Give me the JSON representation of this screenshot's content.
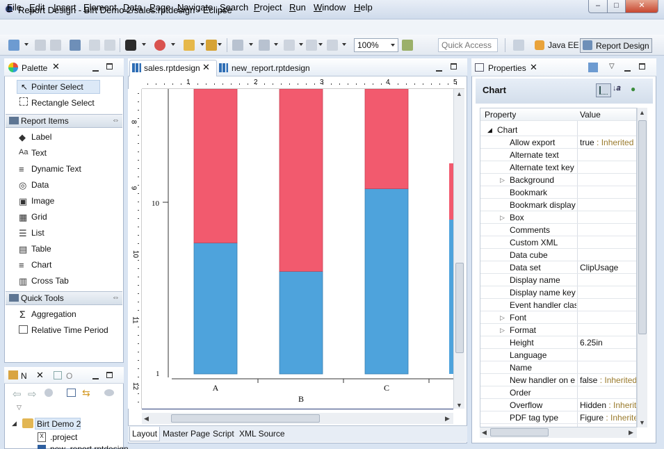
{
  "window": {
    "title": "Report Design - Birt Demo 2/sales.rptdesign - Eclipse"
  },
  "menu": [
    "File",
    "Edit",
    "Insert",
    "Element",
    "Data",
    "Page",
    "Navigate",
    "Search",
    "Project",
    "Run",
    "Window",
    "Help"
  ],
  "toolbar": {
    "zoom": "100%",
    "quick_access": "Quick Access",
    "perspectives": [
      "Java EE",
      "Report Design"
    ]
  },
  "palette": {
    "title": "Palette",
    "tools": [
      "Pointer Select",
      "Rectangle Select"
    ],
    "report_items_label": "Report Items",
    "report_items": [
      "Label",
      "Text",
      "Dynamic Text",
      "Data",
      "Image",
      "Grid",
      "List",
      "Table",
      "Chart",
      "Cross Tab"
    ],
    "quick_tools_label": "Quick Tools",
    "quick_tools": [
      "Aggregation",
      "Relative Time Period"
    ]
  },
  "navigator": {
    "tab_n": "N",
    "tab_o": "O",
    "project": "Birt Demo 2",
    "files": [
      ".project",
      "new_report.rptdesign"
    ]
  },
  "editor": {
    "tabs": [
      "sales.rptdesign",
      "new_report.rptdesign"
    ],
    "ruler_top": [
      "1",
      "2",
      "3",
      "4",
      "5"
    ],
    "ruler_left": [
      "8",
      "9",
      "10",
      "11",
      "12"
    ],
    "bottom_tabs": [
      "Layout",
      "Master Page",
      "Script",
      "XML Source"
    ]
  },
  "chart_data": {
    "type": "bar",
    "stacked": true,
    "categories": [
      "A",
      "B",
      "C"
    ],
    "axis_labels": {
      "ymid": "10",
      "ybottom": "1"
    },
    "colors": {
      "bottom": "#4ea3dc",
      "top": "#f25a6e"
    },
    "series": [
      {
        "values": [
          0.46,
          0.36,
          0.65
        ]
      },
      {
        "values": [
          0.54,
          0.64,
          0.35
        ]
      }
    ]
  },
  "properties": {
    "title": "Properties",
    "section_title": "Chart",
    "columns": [
      "Property",
      "Value"
    ],
    "group": "Chart",
    "rows": [
      {
        "name": "Allow export",
        "value": "true",
        "inherit": " : Inherited",
        "expand": false
      },
      {
        "name": "Alternate text",
        "value": "",
        "inherit": "",
        "expand": false
      },
      {
        "name": "Alternate text key",
        "value": "",
        "inherit": "",
        "expand": false
      },
      {
        "name": "Background",
        "value": "",
        "inherit": "",
        "expand": true
      },
      {
        "name": "Bookmark",
        "value": "",
        "inherit": "",
        "expand": false
      },
      {
        "name": "Bookmark display",
        "value": "",
        "inherit": "",
        "expand": false
      },
      {
        "name": "Box",
        "value": "",
        "inherit": "",
        "expand": true
      },
      {
        "name": "Comments",
        "value": "",
        "inherit": "",
        "expand": false
      },
      {
        "name": "Custom XML",
        "value": "",
        "inherit": "",
        "expand": false
      },
      {
        "name": "Data cube",
        "value": "",
        "inherit": "",
        "expand": false
      },
      {
        "name": "Data set",
        "value": "ClipUsage",
        "inherit": "",
        "expand": false
      },
      {
        "name": "Display name",
        "value": "",
        "inherit": "",
        "expand": false
      },
      {
        "name": "Display name key",
        "value": "",
        "inherit": "",
        "expand": false
      },
      {
        "name": "Event handler clas",
        "value": "",
        "inherit": "",
        "expand": false
      },
      {
        "name": "Font",
        "value": "",
        "inherit": "",
        "expand": true
      },
      {
        "name": "Format",
        "value": "",
        "inherit": "",
        "expand": true
      },
      {
        "name": "Height",
        "value": "6.25in",
        "inherit": "",
        "expand": false
      },
      {
        "name": "Language",
        "value": "",
        "inherit": "",
        "expand": false
      },
      {
        "name": "Name",
        "value": "",
        "inherit": "",
        "expand": false
      },
      {
        "name": "New handler on e",
        "value": "false",
        "inherit": " : Inherited",
        "expand": false
      },
      {
        "name": "Order",
        "value": "",
        "inherit": "",
        "expand": false
      },
      {
        "name": "Overflow",
        "value": "Hidden",
        "inherit": " : Inherit",
        "expand": false
      },
      {
        "name": "PDF tag type",
        "value": "Figure",
        "inherit": " : Inherite",
        "expand": false
      }
    ]
  }
}
